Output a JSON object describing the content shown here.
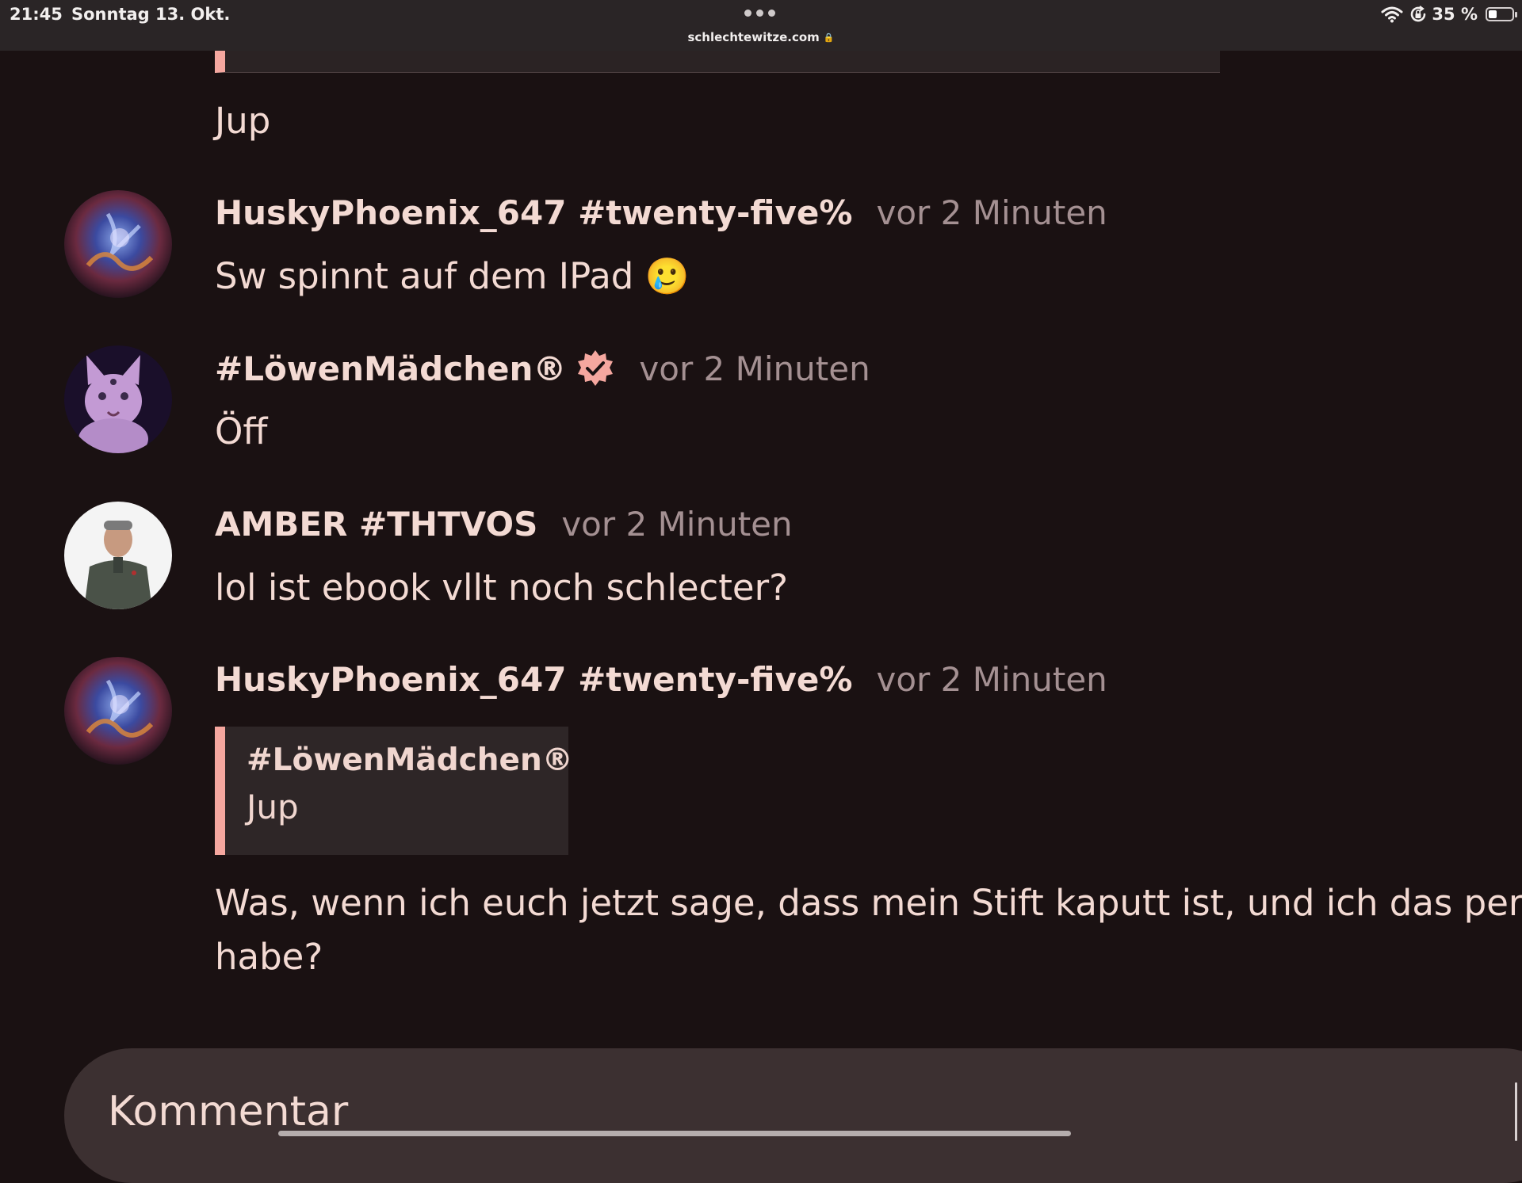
{
  "status_bar": {
    "time": "21:45",
    "date": "Sonntag 13. Okt.",
    "url": "schlechtewitze.com",
    "battery": "35 %",
    "battery_level": 0.35,
    "icons": [
      "wifi-icon",
      "screen-lock-icon",
      "battery-icon",
      "lock-icon",
      "more-dots-icon"
    ]
  },
  "top_message": {
    "text": "Jup"
  },
  "messages": [
    {
      "author": "HuskyPhoenix_647 #twenty-five%",
      "time": "vor 2 Minuten",
      "text": "Sw spinnt auf dem IPad 🥲"
    },
    {
      "author": "#LöwenMädchen®",
      "time": "vor 2 Minuten",
      "text": "Öff",
      "badge": "verified-badge-icon"
    },
    {
      "author": "AMBER #THTVOS",
      "time": "vor 2 Minuten",
      "text": "lol ist ebook vllt noch schlecter?"
    },
    {
      "author": "HuskyPhoenix_647 #twenty-five%",
      "time": "vor 2 Minuten",
      "quote": {
        "author": "#LöwenMädchen®",
        "text": "Jup"
      },
      "text": "Was, wenn ich euch jetzt sage, dass mein Stift kaputt ist, und ich das per habe?"
    }
  ],
  "composer": {
    "placeholder": "Kommentar"
  },
  "colors": {
    "background": "#1a1112",
    "accent": "#f5a79f",
    "text": "#f3dad3",
    "muted": "#a49092",
    "status_bar": "#2a2526",
    "composer": "#3c3031"
  }
}
